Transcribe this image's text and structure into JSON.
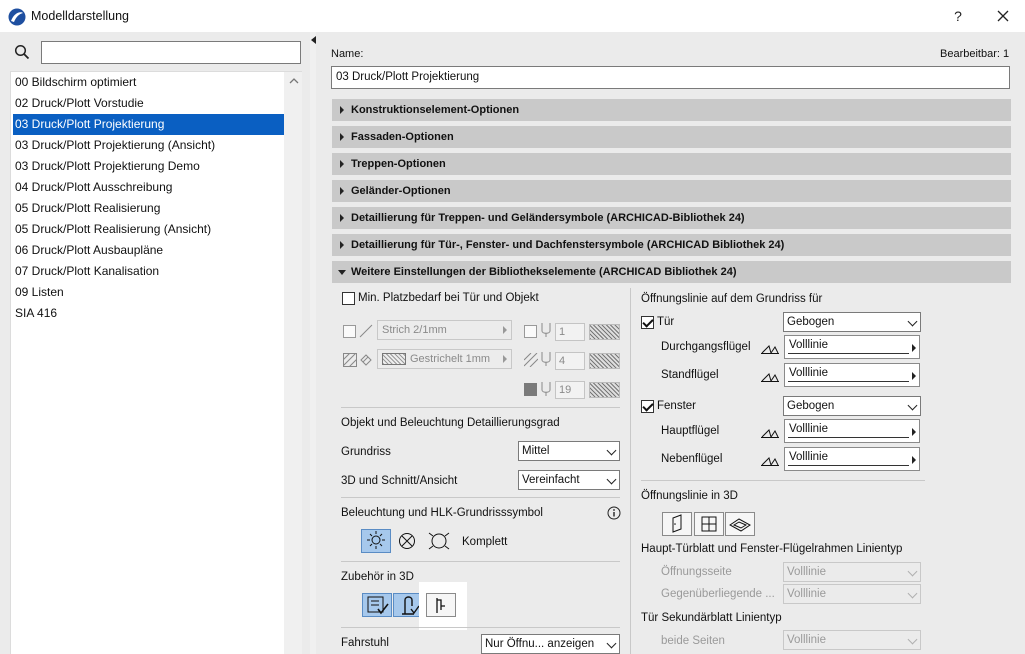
{
  "window": {
    "title": "Modelldarstellung",
    "help": "?"
  },
  "list": {
    "items": [
      "00 Bildschirm optimiert",
      "02 Druck/Plott Vorstudie",
      "03 Druck/Plott Projektierung",
      "03 Druck/Plott Projektierung (Ansicht)",
      "03 Druck/Plott Projektierung Demo",
      "04 Druck/Plott Ausschreibung",
      "05 Druck/Plott Realisierung",
      "05 Druck/Plott Realisierung (Ansicht)",
      "06 Druck/Plott Ausbaupläne",
      "07 Druck/Plott Kanalisation",
      "09 Listen",
      "SIA 416"
    ],
    "selected_index": 2
  },
  "name": {
    "label": "Name:",
    "value": "03 Druck/Plott Projektierung",
    "editable": "Bearbeitbar: 1"
  },
  "sections": [
    "Konstruktionselement-Optionen",
    "Fassaden-Optionen",
    "Treppen-Optionen",
    "Geländer-Optionen",
    "Detaillierung für Treppen- und Geländersymbole (ARCHICAD-Bibliothek 24)",
    "Detaillierung für Tür-, Fenster- und Dachfenstersymbole (ARCHICAD Bibliothek 24)",
    "Weitere Einstellungen der Bibliothekselemente (ARCHICAD Bibliothek 24)"
  ],
  "left_col": {
    "min_space": "Min. Platzbedarf bei Tür und Objekt",
    "line_type": "Strich 2/1mm",
    "fill_type": "Gestrichelt 1mm",
    "pen1": "1",
    "pen2": "4",
    "pen3": "19",
    "detail_heading": "Objekt und Beleuchtung Detaillierungsgrad",
    "grundriss_label": "Grundriss",
    "grundriss_value": "Mittel",
    "schnitt_label": "3D und Schnitt/Ansicht",
    "schnitt_value": "Vereinfacht",
    "light_heading": "Beleuchtung und HLK-Grundrisssymbol",
    "light_value": "Komplett",
    "zubehoer_heading": "Zubehör in 3D",
    "fahrstuhl_label": "Fahrstuhl",
    "fahrstuhl_value": "Nur Öffnu... anzeigen"
  },
  "right_col": {
    "heading": "Öffnungslinie auf dem Grundriss für",
    "tuer_label": "Tür",
    "tuer_value": "Gebogen",
    "durchgang_label": "Durchgangsflügel",
    "durchgang_value": "Volllinie",
    "stand_label": "Standflügel",
    "stand_value": "Volllinie",
    "fenster_label": "Fenster",
    "fenster_value": "Gebogen",
    "haupt_label": "Hauptflügel",
    "haupt_value": "Volllinie",
    "neben_label": "Nebenflügel",
    "neben_value": "Volllinie",
    "heading3d": "Öffnungslinie in 3D",
    "frame_heading": "Haupt-Türblatt und Fenster-Flügelrahmen Linientyp",
    "oeffnungsseite_label": "Öffnungsseite",
    "oeffnungsseite_value": "Volllinie",
    "gegen_label": "Gegenüberliegende ...",
    "gegen_value": "Volllinie",
    "sekundaer_heading": "Tür Sekundärblatt Linientyp",
    "beide_label": "beide Seiten",
    "beide_value": "Volllinie"
  }
}
